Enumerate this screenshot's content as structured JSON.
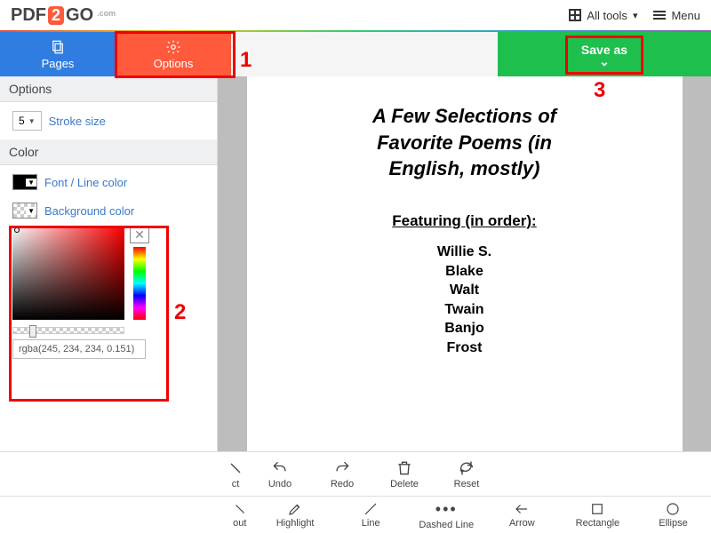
{
  "logo": {
    "p": "PDF",
    "mid": "2",
    "go": "GO",
    "com": ".com"
  },
  "top": {
    "alltools": "All tools",
    "menu": "Menu"
  },
  "tabs": {
    "pages": "Pages",
    "options": "Options",
    "saveas": "Save as"
  },
  "side": {
    "options_header": "Options",
    "stroke_value": "5",
    "stroke_label": "Stroke size",
    "color_header": "Color",
    "font_line": "Font / Line color",
    "bg": "Background color",
    "rgba": "rgba(245, 234, 234, 0.151)"
  },
  "doc": {
    "title": "A Few Selections of Favorite Poems (in English, mostly)",
    "feat": "Featuring (in order):",
    "names": [
      "Willie S.",
      "Blake",
      "Walt",
      "Twain",
      "Banjo",
      "Frost"
    ]
  },
  "tb1": {
    "ct": "ct",
    "undo": "Undo",
    "redo": "Redo",
    "del": "Delete",
    "reset": "Reset"
  },
  "tb2": {
    "out": "out",
    "hi": "Highlight",
    "line": "Line",
    "dash": "Dashed Line",
    "arrow": "Arrow",
    "rect": "Rectangle",
    "ell": "Ellipse"
  },
  "anno": {
    "n1": "1",
    "n2": "2",
    "n3": "3"
  }
}
